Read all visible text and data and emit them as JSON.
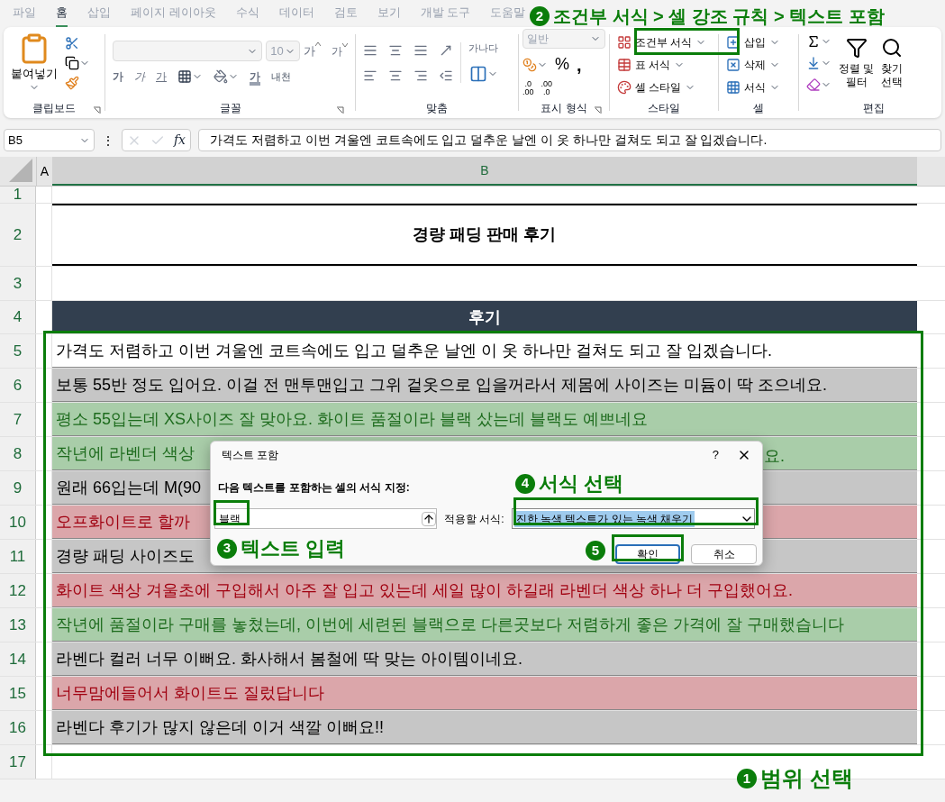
{
  "ribbon_tabs": [
    {
      "label": "파일",
      "selected": false
    },
    {
      "label": "홈",
      "selected": true
    },
    {
      "label": "삽입",
      "selected": false
    },
    {
      "label": "페이지 레이아웃",
      "selected": false
    },
    {
      "label": "수식",
      "selected": false
    },
    {
      "label": "데이터",
      "selected": false
    },
    {
      "label": "검토",
      "selected": false
    },
    {
      "label": "보기",
      "selected": false
    },
    {
      "label": "개발 도구",
      "selected": false
    },
    {
      "label": "도움말",
      "selected": false
    }
  ],
  "ribbon": {
    "clipboard": {
      "paste": "붙여넣기",
      "group": "클립보드"
    },
    "font": {
      "font_size": "10",
      "grow": "가",
      "shrink": "가",
      "styles": [
        {
          "kind": "bold",
          "label": "가"
        },
        {
          "kind": "italic",
          "label": "가"
        },
        {
          "kind": "underline",
          "label": "가"
        }
      ],
      "font_color": "가",
      "phonetic": "내천",
      "group": "글꼴"
    },
    "alignment": {
      "wrap": "가나다",
      "group": "맞춤"
    },
    "number": {
      "format": "일반",
      "percent": "%",
      "comma": ",",
      "increase_decimal": [
        ".0",
        ".00"
      ],
      "decrease_decimal": [
        ".00",
        ".0"
      ],
      "group": "표시 형식"
    },
    "styles": {
      "buttons": [
        "조건부 서식",
        "표 서식",
        "셀 스타일"
      ],
      "group": "스타일"
    },
    "cells": {
      "buttons": [
        "삽입",
        "삭제",
        "서식"
      ],
      "group": "셀"
    },
    "editing": {
      "sort_filter": [
        "정렬 및",
        "필터"
      ],
      "find_select": [
        "찾기",
        "선택"
      ],
      "group": "편집"
    }
  },
  "formula_bar": {
    "name_box": "B5",
    "more": "⋮",
    "fx": "fx",
    "formula": "가격도 저렴하고 이번 겨울엔 코트속에도 입고 덜추운 날엔 이 옷 하나만 걸쳐도 되고 잘 입겠습니다."
  },
  "columns": [
    "A",
    "B"
  ],
  "rows": [
    {
      "number": "1",
      "kind": "empty"
    },
    {
      "number": "2",
      "kind": "title",
      "text": "경량 패딩 판매 후기"
    },
    {
      "number": "3",
      "kind": "empty"
    },
    {
      "number": "4",
      "kind": "header",
      "text": "후기"
    },
    {
      "number": "5",
      "kind": "plain",
      "text": "가격도 저렴하고 이번 겨울엔 코트속에도 입고 덜추운 날엔 이 옷 하나만 걸쳐도 되고 잘 입겠습니다."
    },
    {
      "number": "6",
      "kind": "gray",
      "text": "보통 55반 정도 입어요. 이걸 전 맨투맨입고 그위 겉옷으로 입을꺼라서 제몸에 사이즈는 미듐이 딱 조으네요."
    },
    {
      "number": "7",
      "kind": "green",
      "text": "평소 55입는데 XS사이즈 잘 맞아요. 화이트 품절이라 블랙 샀는데 블랙도 예쁘네요"
    },
    {
      "number": "8",
      "kind": "green",
      "text": "작년에 라벤더 색상",
      "tail": "요."
    },
    {
      "number": "9",
      "kind": "gray",
      "text": "원래 66입는데 M(90"
    },
    {
      "number": "10",
      "kind": "red",
      "text": "오프화이트로 할까"
    },
    {
      "number": "11",
      "kind": "gray",
      "text": "경량 패딩 사이즈도"
    },
    {
      "number": "12",
      "kind": "red",
      "text": "화이트 색상 겨울초에 구입해서 아주 잘 입고 있는데 세일 많이 하길래 라벤더 색상 하나 더 구입했어요."
    },
    {
      "number": "13",
      "kind": "green",
      "text": "작년에 품절이라 구매를 놓쳤는데, 이번에 세련된 블랙으로 다른곳보다 저렴하게 좋은 가격에 잘 구매했습니다"
    },
    {
      "number": "14",
      "kind": "gray",
      "text": "라벤다 컬러 너무 이뻐요. 화사해서 봄철에 딱 맞는 아이템이네요."
    },
    {
      "number": "15",
      "kind": "red",
      "text": "너무맘에들어서 화이트도 질렀답니다"
    },
    {
      "number": "16",
      "kind": "gray",
      "text": "라벤다 후기가 많지 않은데 이거 색깔 이뻐요!!"
    },
    {
      "number": "17",
      "kind": "empty"
    }
  ],
  "dialog": {
    "title": "텍스트 포함",
    "help": "?",
    "prompt": "다음 텍스트를 포함하는 셀의 서식 지정:",
    "value": "블랙",
    "format_label": "적용할 서식:",
    "format_value": "진한 녹색 텍스트가 있는 녹색 채우기",
    "ok": "확인",
    "cancel": "취소"
  },
  "annotations": [
    {
      "number": "1",
      "label": "범위 선택"
    },
    {
      "number": "2",
      "label": "조건부 서식 > 셀 강조 규칙 > 텍스트 포함"
    },
    {
      "number": "3",
      "label": "텍스트 입력"
    },
    {
      "number": "4",
      "label": "서식 선택"
    },
    {
      "number": "5"
    }
  ]
}
